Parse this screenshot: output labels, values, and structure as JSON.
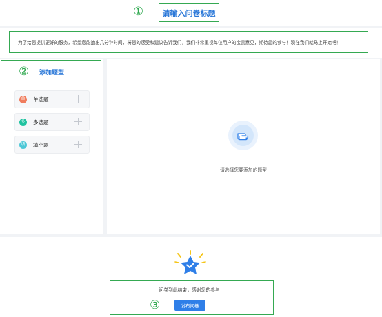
{
  "markers": {
    "one": "①",
    "two": "②",
    "three": "③"
  },
  "survey": {
    "title": "请输入问卷标题",
    "description": "为了给您提供更好的服务，希望您能抽出几分钟时间，将您的感受和建议告诉我们，我们非常重视每位用户的宝贵意见，期待您的参与！现在我们就马上开始吧！"
  },
  "sidebar": {
    "heading": "添加题型",
    "items": [
      {
        "icon_text": "单",
        "label": "单选题",
        "color": "#f07c5d",
        "icon": "radio-type-icon"
      },
      {
        "icon_text": "多",
        "label": "多选题",
        "color": "#20c3a0",
        "icon": "checkbox-type-icon"
      },
      {
        "icon_text": "填",
        "label": "填空题",
        "color": "#4cc7d6",
        "icon": "fill-blank-type-icon"
      }
    ]
  },
  "main": {
    "hint": "请选择您要添加的题型"
  },
  "footer": {
    "end_text": "问卷到此结束，感谢您的参与！",
    "publish_label": "发布问卷"
  },
  "colors": {
    "accent": "#2b78d8",
    "annotation_green": "#35a952",
    "button_blue": "#2f7fe8",
    "star_blue": "#2f7fe8",
    "star_sparkle": "#f5c518"
  }
}
